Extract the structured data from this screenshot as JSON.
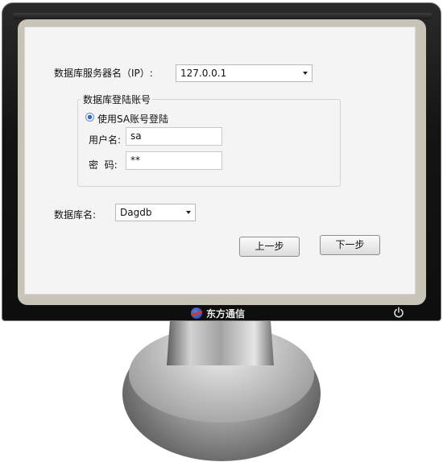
{
  "form": {
    "server_label": "数据库服务器名（IP）:",
    "server_value": "127.0.0.1",
    "group_title": "数据库登陆账号",
    "sa_radio_label": "使用SA账号登陆",
    "username_label": "用户名:",
    "username_value": "sa",
    "password_label": "密  码:",
    "password_value": "**",
    "database_label": "数据库名:",
    "database_value": "Dagdb",
    "prev_button": "上一步",
    "next_button": "下一步"
  },
  "monitor": {
    "brand": "东方通信",
    "power_icon": "power-icon",
    "logo_icon": "brand-logo-icon",
    "dropdown_icon": "chevron-down-icon"
  },
  "colors": {
    "bezel": "#141414",
    "screen": "#f4f4f4",
    "radio_selected": "#2f6bd1"
  }
}
